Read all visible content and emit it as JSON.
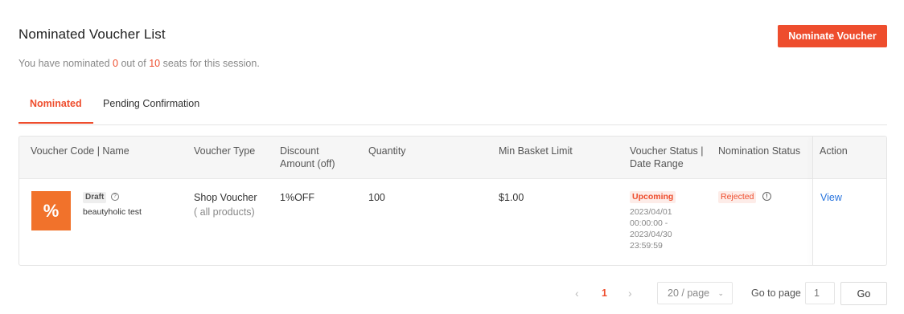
{
  "header": {
    "title": "Nominated Voucher List",
    "nominate_button": "Nominate Voucher"
  },
  "subtitle": {
    "prefix": "You have nominated",
    "nominated": "0",
    "middle": "out of",
    "total": "10",
    "suffix": "seats for this session."
  },
  "tabs": [
    {
      "label": "Nominated",
      "active": true
    },
    {
      "label": "Pending Confirmation",
      "active": false
    }
  ],
  "table": {
    "columns": [
      "Voucher Code | Name",
      "Voucher Type",
      "Discount Amount (off)",
      "Quantity",
      "Min Basket Limit",
      "Voucher Status | Date Range",
      "Nomination Status",
      "Action"
    ],
    "rows": [
      {
        "thumb_symbol": "%",
        "badge": "Draft",
        "name": "beautyholic test",
        "voucher_type": "Shop Voucher",
        "voucher_scope": "( all products)",
        "discount": "1%OFF",
        "quantity": "100",
        "min_basket": "$1.00",
        "voucher_status": "Upcoming",
        "date_start_date": "2023/04/01",
        "date_start_time": "00:00:00 -",
        "date_end_date": "2023/04/30",
        "date_end_time": "23:59:59",
        "nomination_status": "Rejected",
        "action": "View"
      }
    ]
  },
  "pagination": {
    "current_page": "1",
    "page_size": "20 / page",
    "goto_label": "Go to page",
    "goto_placeholder": "1",
    "go_button": "Go"
  },
  "colors": {
    "accent": "#ee4d2d",
    "link": "#2673dd",
    "thumb": "#f1722b"
  },
  "icons": [
    "question-circle-icon",
    "info-circle-icon",
    "chevron-left-icon",
    "chevron-right-icon",
    "chevron-down-icon"
  ]
}
